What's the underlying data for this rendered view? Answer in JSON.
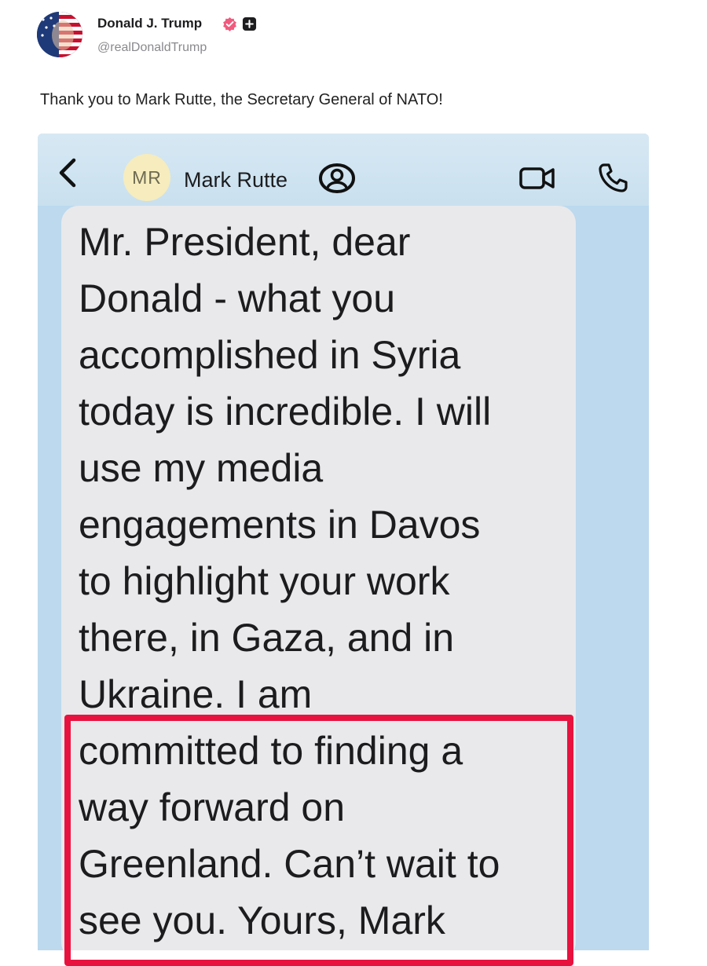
{
  "post": {
    "author_name": "Donald J. Trump",
    "handle": "@realDonaldTrump",
    "text": "Thank you to Mark Rutte, the Secretary General of NATO!",
    "verified_color": "#f05a7e"
  },
  "screenshot": {
    "contact_initials": "MR",
    "contact_name": "Mark Rutte",
    "message": "Mr. President, dear\nDonald - what you\naccomplished in Syria\ntoday is incredible. I will\nuse my media\nengagements in Davos\nto highlight your work\nthere, in Gaza, and in\nUkraine. I am\ncommitted to finding a\nway forward on\nGreenland. Can’t wait to\nsee you. Yours, Mark",
    "highlight_color": "#e8123f",
    "icons": [
      "back-chevron-icon",
      "contact-badge-icon",
      "video-camera-icon",
      "phone-icon"
    ]
  }
}
